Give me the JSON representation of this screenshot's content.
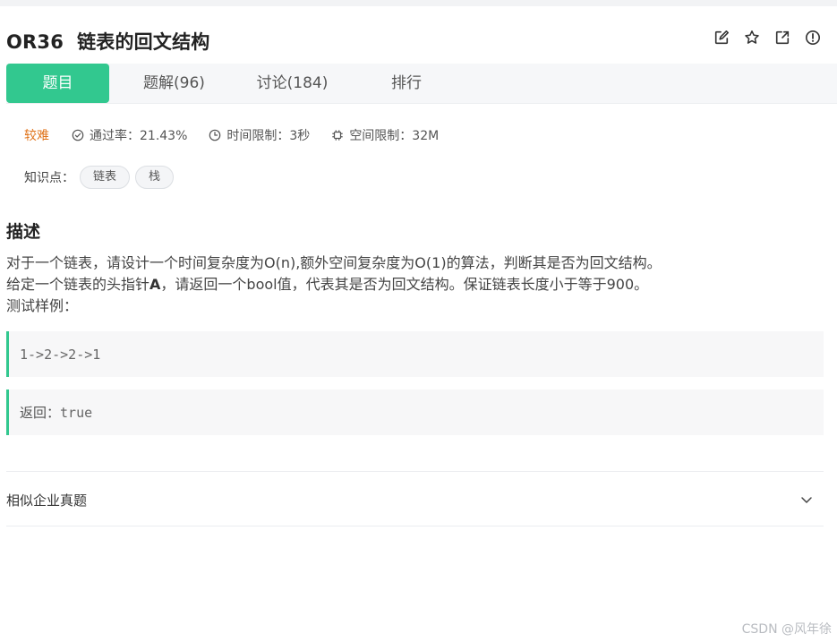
{
  "problem": {
    "id": "OR36",
    "title": "链表的回文结构"
  },
  "tabs": [
    {
      "label": "题目"
    },
    {
      "label": "题解(96)"
    },
    {
      "label": "讨论(184)"
    },
    {
      "label": "排行"
    }
  ],
  "meta": {
    "difficulty": "较难",
    "pass_rate": "通过率：21.43%",
    "time_limit": "时间限制：3秒",
    "space_limit": "空间限制：32M"
  },
  "tags": {
    "label": "知识点：",
    "items": [
      "链表",
      "栈"
    ]
  },
  "description": {
    "heading": "描述",
    "line1": "对于一个链表，请设计一个时间复杂度为O(n),额外空间复杂度为O(1)的算法，判断其是否为回文结构。",
    "line2_prefix": "给定一个链表的头指针",
    "line2_bold": "A",
    "line2_suffix": "，请返回一个bool值，代表其是否为回文结构。保证链表长度小于等于900。",
    "line3": "测试样例："
  },
  "example": {
    "input": "1->2->2->1",
    "output_label": "返回：",
    "output_value": "true"
  },
  "similar": {
    "label": "相似企业真题"
  },
  "watermark": "CSDN @风年徐",
  "colors": {
    "accent": "#32c88f",
    "difficulty": "#e0731a"
  }
}
